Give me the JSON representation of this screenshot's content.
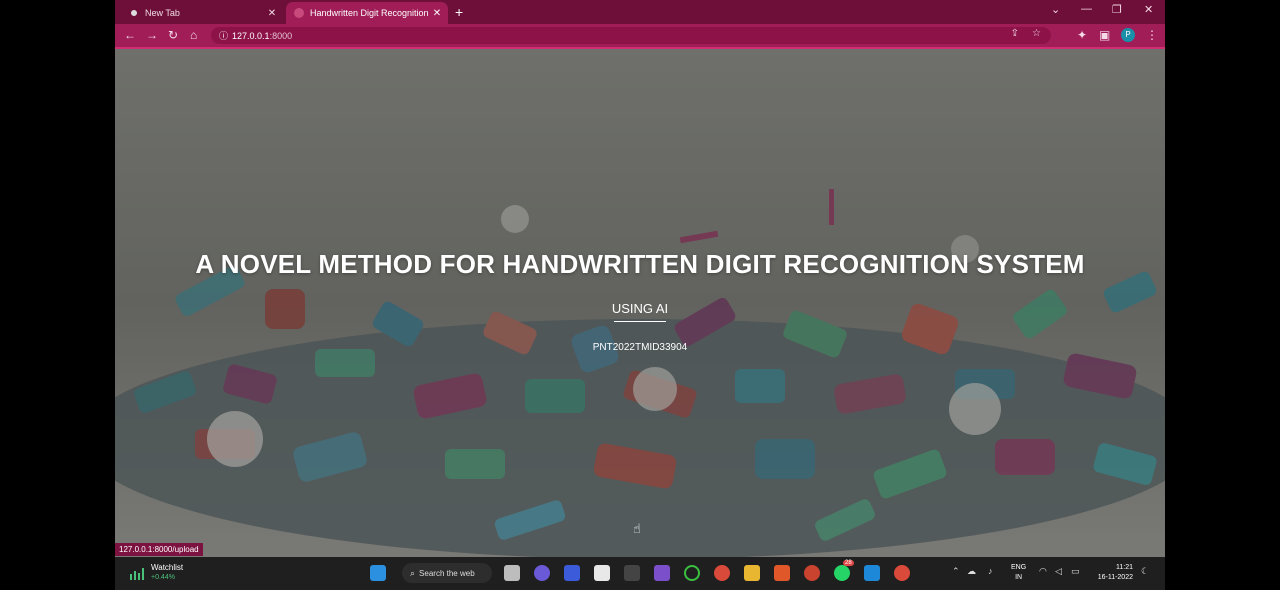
{
  "browser": {
    "tabs": [
      {
        "title": "New Tab",
        "favicon_color": "#e8e8e8"
      },
      {
        "title": "Handwritten Digit Recognition",
        "favicon_color": "#c84a7c",
        "active": true
      }
    ],
    "new_tab_symbol": "+",
    "url": {
      "host": "127.0.0.1",
      "port": ":8000"
    },
    "profile_initial": "P",
    "accent_color": "#a01d58",
    "status_url": "127.0.0.1:8000/upload"
  },
  "page": {
    "headline": "A NOVEL METHOD FOR HANDWRITTEN DIGIT RECOGNITION SYSTEM",
    "subtitle": "USING AI",
    "team_id": "PNT2022TMID33904"
  },
  "taskbar": {
    "watchlist_label": "Watchlist",
    "watchlist_change": "+0.44%",
    "search_label": "Search the web",
    "whatsapp_badge": "28",
    "lang_line1": "ENG",
    "lang_line2": "IN",
    "time": "11:21",
    "date": "16-11-2022"
  }
}
